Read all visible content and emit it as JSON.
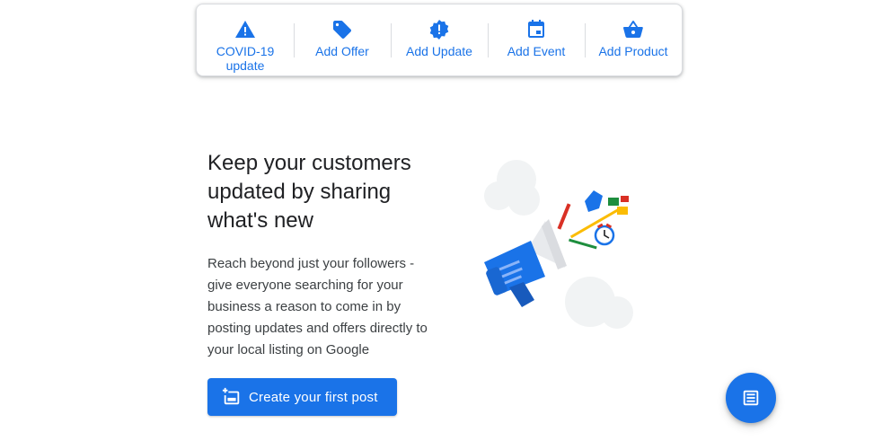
{
  "toolbar": {
    "items": [
      {
        "label": "COVID-19 update",
        "icon": "warning-icon"
      },
      {
        "label": "Add Offer",
        "icon": "tag-icon"
      },
      {
        "label": "Add Update",
        "icon": "alert-badge-icon"
      },
      {
        "label": "Add Event",
        "icon": "calendar-icon"
      },
      {
        "label": "Add Product",
        "icon": "basket-icon"
      }
    ]
  },
  "main": {
    "headline": "Keep your customers updated by sharing what's new",
    "description": "Reach beyond just your followers - give everyone searching for your business a reason to come in by posting updates and offers directly to your local listing on Google",
    "cta_label": "Create your first post",
    "illustration": "megaphone-illustration"
  },
  "fab": {
    "icon": "post-icon"
  },
  "colors": {
    "accent": "#1a73e8",
    "text": "#202124",
    "divider": "#dadce0"
  }
}
